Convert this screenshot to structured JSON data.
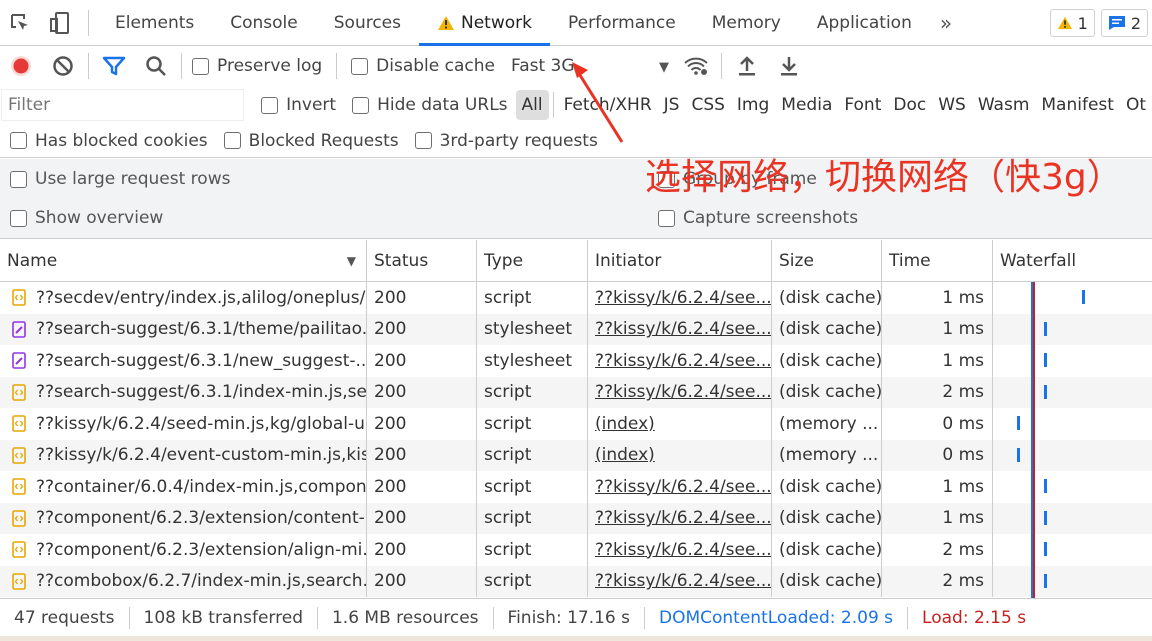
{
  "tabs": [
    "Elements",
    "Console",
    "Sources",
    "Network",
    "Performance",
    "Memory",
    "Application"
  ],
  "more_icon": "»",
  "badges": {
    "warnings": "1",
    "messages": "2"
  },
  "toolbar": {
    "preserve_log": "Preserve log",
    "disable_cache": "Disable cache",
    "throttle": "Fast 3G"
  },
  "filter": {
    "placeholder": "Filter",
    "invert": "Invert",
    "hide_data_urls": "Hide data URLs",
    "types": [
      "All",
      "Fetch/XHR",
      "JS",
      "CSS",
      "Img",
      "Media",
      "Font",
      "Doc",
      "WS",
      "Wasm",
      "Manifest",
      "Ot"
    ]
  },
  "extra_filters": [
    "Has blocked cookies",
    "Blocked Requests",
    "3rd-party requests"
  ],
  "settings": {
    "large_rows": "Use large request rows",
    "group_by_frame": "Group by frame",
    "show_overview": "Show overview",
    "capture_screenshots": "Capture screenshots"
  },
  "columns": [
    "Name",
    "Status",
    "Type",
    "Initiator",
    "Size",
    "Time",
    "Waterfall"
  ],
  "rows": [
    {
      "name": "??secdev/entry/index.js,alilog/oneplus/...",
      "status": "200",
      "type": "script",
      "initiator": "??kissy/k/6.2.4/see...",
      "size": "(disk cache)",
      "time": "1 ms",
      "icon": "script"
    },
    {
      "name": "??search-suggest/6.3.1/theme/pailitao...",
      "status": "200",
      "type": "stylesheet",
      "initiator": "??kissy/k/6.2.4/see...",
      "size": "(disk cache)",
      "time": "1 ms",
      "icon": "stylesheet"
    },
    {
      "name": "??search-suggest/6.3.1/new_suggest-...",
      "status": "200",
      "type": "stylesheet",
      "initiator": "??kissy/k/6.2.4/see...",
      "size": "(disk cache)",
      "time": "1 ms",
      "icon": "stylesheet"
    },
    {
      "name": "??search-suggest/6.3.1/index-min.js,se...",
      "status": "200",
      "type": "script",
      "initiator": "??kissy/k/6.2.4/see...",
      "size": "(disk cache)",
      "time": "2 ms",
      "icon": "script"
    },
    {
      "name": "??kissy/k/6.2.4/seed-min.js,kg/global-u...",
      "status": "200",
      "type": "script",
      "initiator": "(index)",
      "size": "(memory ...",
      "time": "0 ms",
      "icon": "script"
    },
    {
      "name": "??kissy/k/6.2.4/event-custom-min.js,kis...",
      "status": "200",
      "type": "script",
      "initiator": "(index)",
      "size": "(memory ...",
      "time": "0 ms",
      "icon": "script"
    },
    {
      "name": "??container/6.0.4/index-min.js,compon...",
      "status": "200",
      "type": "script",
      "initiator": "??kissy/k/6.2.4/see...",
      "size": "(disk cache)",
      "time": "1 ms",
      "icon": "script"
    },
    {
      "name": "??component/6.2.3/extension/content-...",
      "status": "200",
      "type": "script",
      "initiator": "??kissy/k/6.2.4/see...",
      "size": "(disk cache)",
      "time": "1 ms",
      "icon": "script"
    },
    {
      "name": "??component/6.2.3/extension/align-mi...",
      "status": "200",
      "type": "script",
      "initiator": "??kissy/k/6.2.4/see...",
      "size": "(disk cache)",
      "time": "2 ms",
      "icon": "script"
    },
    {
      "name": "??combobox/6.2.7/index-min.js,search...",
      "status": "200",
      "type": "script",
      "initiator": "??kissy/k/6.2.4/see...",
      "size": "(disk cache)",
      "time": "2 ms",
      "icon": "script"
    }
  ],
  "status_bar": {
    "requests": "47 requests",
    "transferred": "108 kB transferred",
    "resources": "1.6 MB resources",
    "finish": "Finish: 17.16 s",
    "dom_content_loaded": "DOMContentLoaded: 2.09 s",
    "load": "Load: 2.15 s"
  },
  "annotation": "选择网络，切换网络（快3g）",
  "colors": {
    "accent": "#1a73e8",
    "record": "#e53935",
    "annotation": "#ea3323",
    "dcl": "#1a73e8",
    "load": "#c5221f"
  }
}
